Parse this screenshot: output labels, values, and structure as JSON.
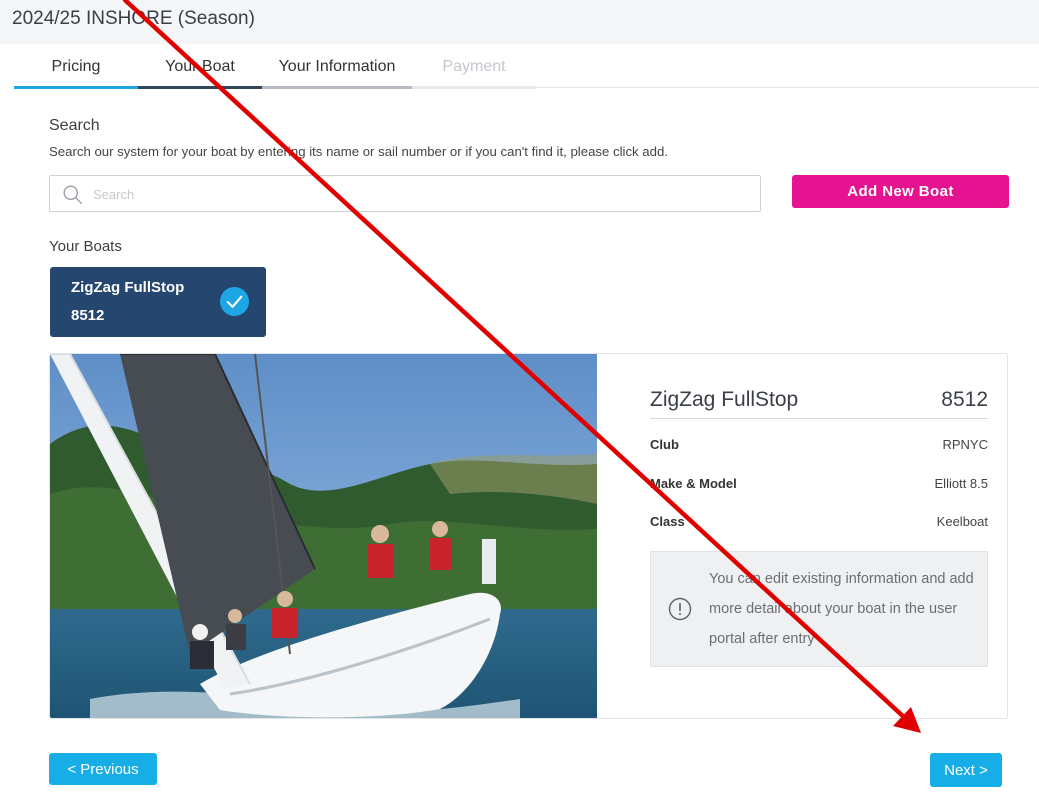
{
  "header": {
    "title": "2024/25 INSHORE (Season)"
  },
  "tabs": [
    {
      "label": "Pricing",
      "state": "completed"
    },
    {
      "label": "Your Boat",
      "state": "active"
    },
    {
      "label": "Your Information",
      "state": "upcoming"
    },
    {
      "label": "Payment",
      "state": "disabled"
    }
  ],
  "search": {
    "title": "Search",
    "description": "Search our system for your boat by entering its name or sail number or if you can't find it, please click add.",
    "placeholder": "Search",
    "value": "",
    "add_button_label": "Add New Boat"
  },
  "your_boats": {
    "title": "Your Boats",
    "items": [
      {
        "name": "ZigZag FullStop",
        "sail_number": "8512",
        "selected": true
      }
    ]
  },
  "boat_detail": {
    "name": "ZigZag FullStop",
    "sail_number": "8512",
    "rows": [
      {
        "label": "Club",
        "value": "RPNYC"
      },
      {
        "label": "Make & Model",
        "value": "Elliott 8.5"
      },
      {
        "label": "Class",
        "value": "Keelboat"
      }
    ],
    "note": "You can edit existing information and add more detail about your boat in the user portal after entry"
  },
  "nav": {
    "previous_label": "< Previous",
    "next_label": "Next >"
  },
  "icons": {
    "search": "search-icon",
    "selected": "check-circle-icon",
    "note": "info-circle-icon"
  },
  "colors": {
    "primary": "#17aee8",
    "accent": "#e5138f",
    "boat_card": "#25466f",
    "annotation": "#e00000"
  }
}
